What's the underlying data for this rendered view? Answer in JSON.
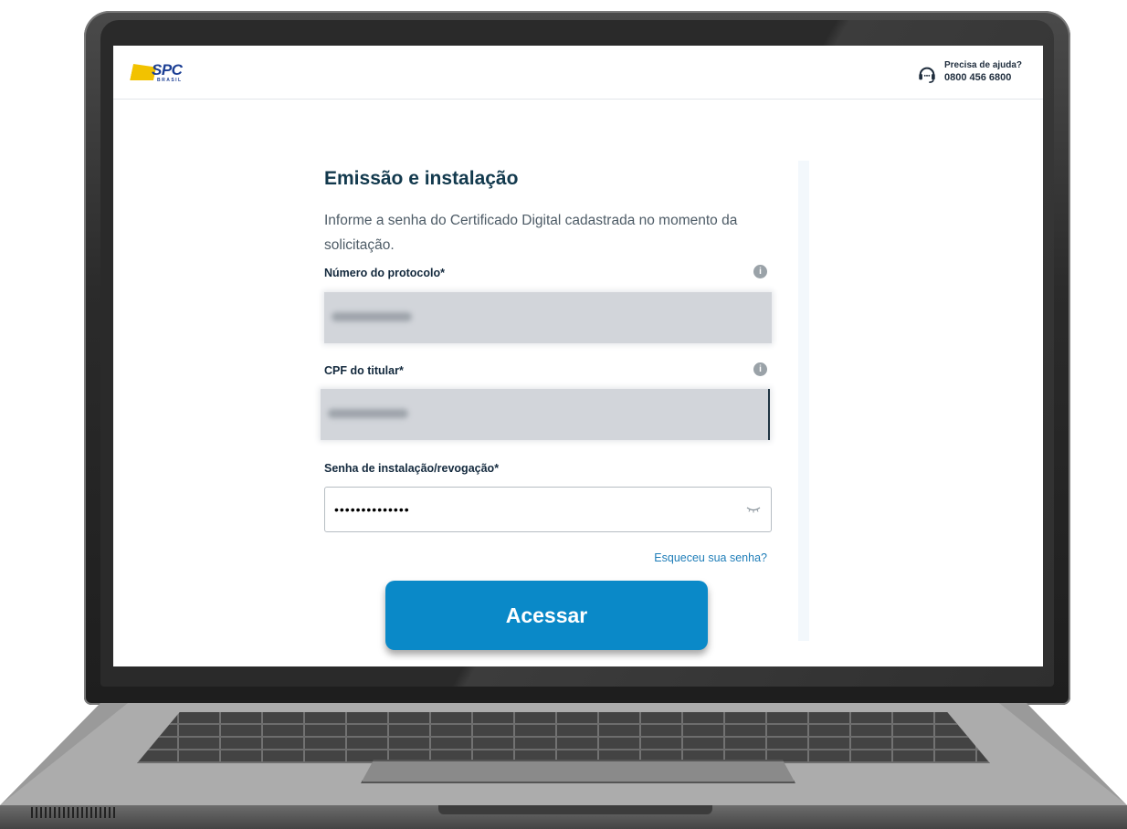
{
  "header": {
    "logo_text": "SPC",
    "logo_subtext": "BRASIL",
    "help_title": "Precisa de ajuda?",
    "help_phone": "0800 456 6800",
    "help_icon": "headset-icon"
  },
  "form": {
    "title": "Emissão e instalação",
    "description": "Informe a senha do Certificado Digital cadastrada no momento da solicitação.",
    "protocol_label": "Número do protocolo*",
    "cpf_label": "CPF do titular*",
    "password_label": "Senha de instalação/revogação*",
    "password_value": "••••••••••••••",
    "forgot_link": "Esqueceu sua senha?",
    "submit_label": "Acessar",
    "info_icon": "info-icon",
    "eye_icon": "eye-closed-icon"
  },
  "colors": {
    "brand_blue": "#1c3f94",
    "brand_yellow": "#f2c200",
    "button": "#0a89c8",
    "link": "#1e7db8",
    "title": "#12394d"
  }
}
